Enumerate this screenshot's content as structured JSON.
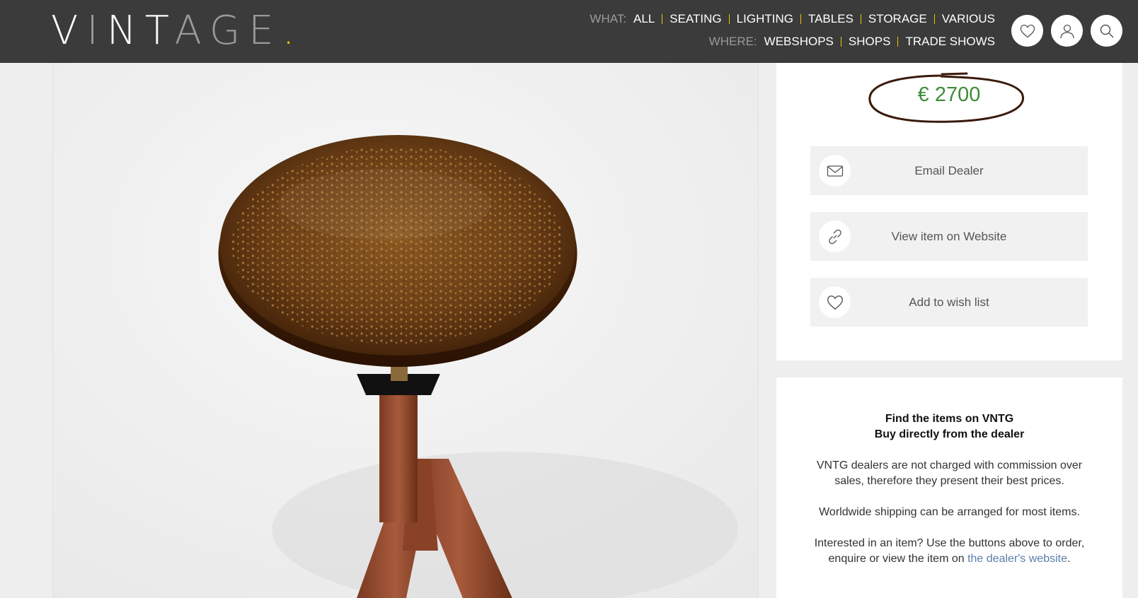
{
  "header": {
    "logo": {
      "part1": "V",
      "part2": "I",
      "part3": "NT",
      "part4": "A",
      "part5": "GE",
      "dot": "."
    },
    "what_label": "WHAT:",
    "what_items": [
      "ALL",
      "SEATING",
      "LIGHTING",
      "TABLES",
      "STORAGE",
      "VARIOUS"
    ],
    "where_label": "WHERE:",
    "where_items": [
      "WEBSHOPS",
      "SHOPS",
      "TRADE SHOWS"
    ],
    "icons": [
      "heart-icon",
      "user-icon",
      "search-icon"
    ]
  },
  "product": {
    "price": "€ 2700"
  },
  "actions": [
    {
      "label": "Email Dealer",
      "icon": "envelope-icon"
    },
    {
      "label": "View item on Website",
      "icon": "link-icon"
    },
    {
      "label": "Add to wish list",
      "icon": "heart-icon"
    }
  ],
  "info": {
    "heading1": "Find the items on VNTG",
    "heading2": "Buy directly from the dealer",
    "para1": "VNTG dealers are not charged with commission over sales, therefore they present their best prices.",
    "para2": "Worldwide shipping can be arranged for most items.",
    "para3_prefix": "Interested in an item? Use the buttons above to order, enquire or view the item on ",
    "para3_link": "the dealer's website",
    "para3_suffix": "."
  },
  "colors": {
    "header_bg": "#3b3b3b",
    "accent": "#f2c400",
    "price": "#3c8c36",
    "link": "#5b7da8"
  }
}
